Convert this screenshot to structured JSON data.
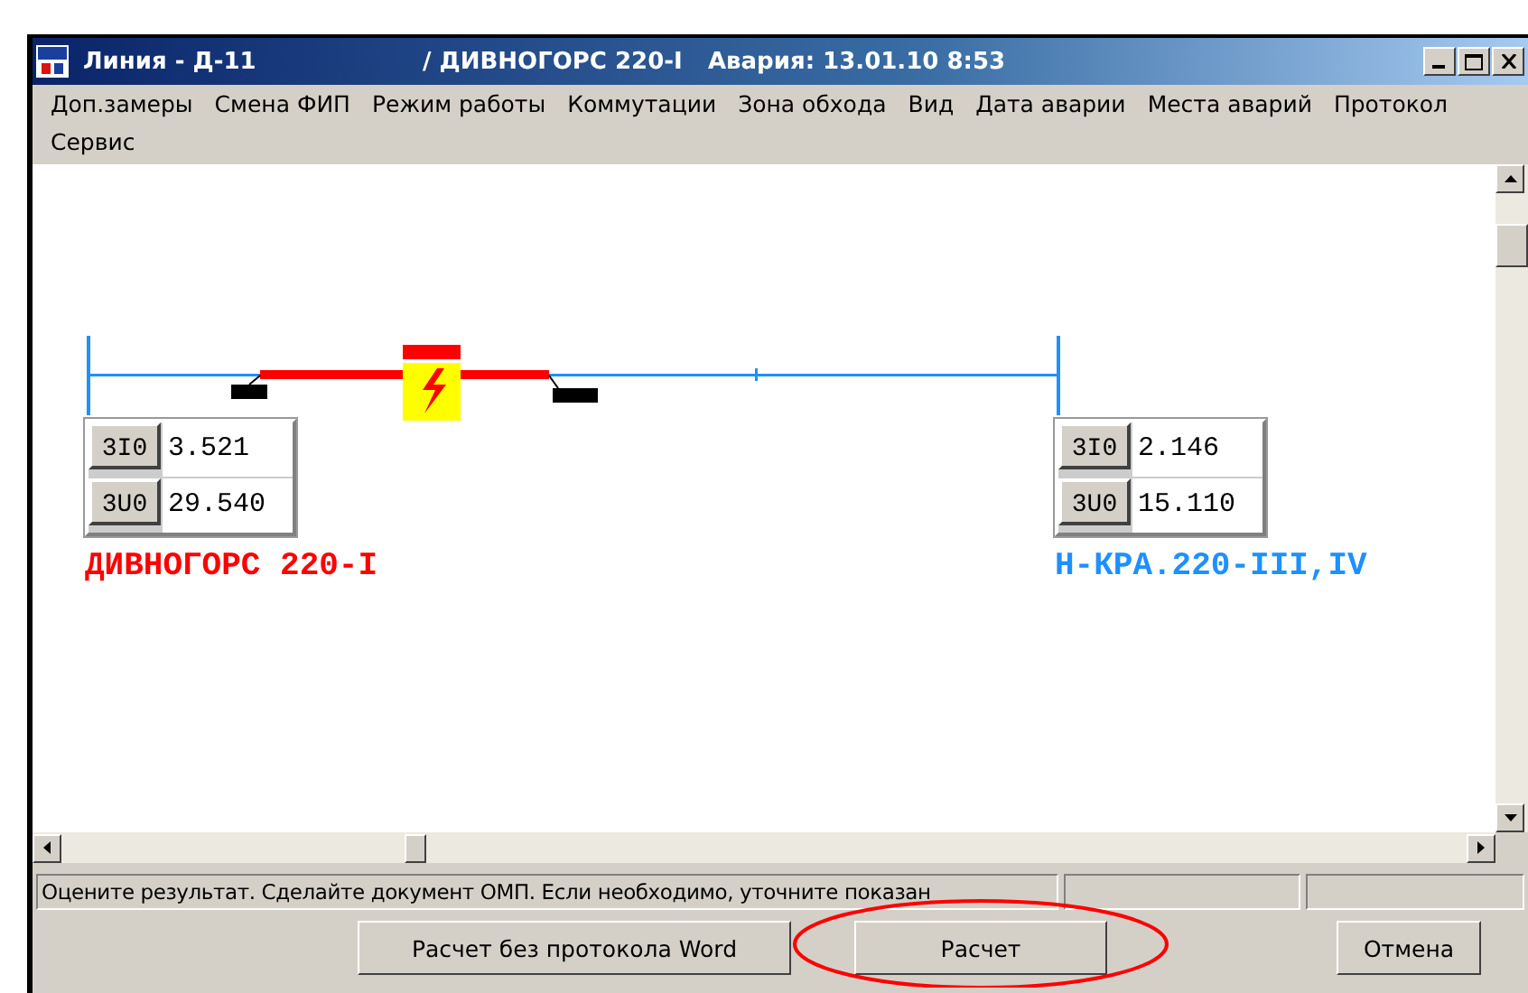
{
  "window": {
    "title": "Линия - Д-11",
    "line_name": "/ ДИВНОГОРС 220-I",
    "fault": "Авария: 13.01.10  8:53"
  },
  "menu": [
    "Доп.замеры",
    "Смена ФИП",
    "Режим работы",
    "Коммутации",
    "Зона обхода",
    "Вид",
    "Дата аварии",
    "Места аварий",
    "Протокол",
    "Сервис"
  ],
  "substations": [
    {
      "name": "ДИВНОГОРС 220-I",
      "color": "#ff0000",
      "readings": [
        {
          "label": "3I0",
          "value": "3.521"
        },
        {
          "label": "3U0",
          "value": "29.540"
        }
      ]
    },
    {
      "name": "Н-КРА.220-III,IV",
      "color": "#1e90ff",
      "readings": [
        {
          "label": "3I0",
          "value": "2.146"
        },
        {
          "label": "3U0",
          "value": "15.110"
        }
      ]
    }
  ],
  "status_bar": {
    "message": "Оцените результат. Сделайте документ ОМП. Если необходимо, уточните показан"
  },
  "buttons": [
    {
      "label": "Расчет без протокола Word",
      "circled": false
    },
    {
      "label": "Расчет",
      "circled": true
    },
    {
      "label": "Отмена",
      "circled": false
    }
  ]
}
